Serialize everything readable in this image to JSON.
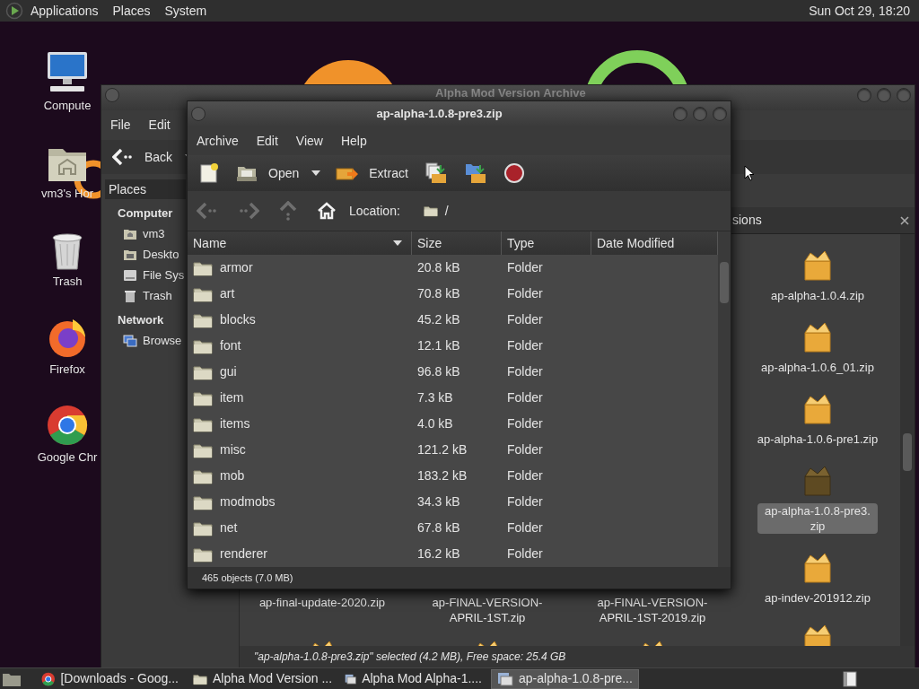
{
  "top_panel": {
    "menus": [
      "Applications",
      "Places",
      "System"
    ],
    "clock": "Sun Oct 29, 18:20"
  },
  "desktop_icons": [
    {
      "kind": "computer",
      "label": "Compute"
    },
    {
      "kind": "home",
      "label": "vm3's Hor"
    },
    {
      "kind": "trash",
      "label": "Trash"
    },
    {
      "kind": "firefox",
      "label": "Firefox"
    },
    {
      "kind": "chrome",
      "label": "Google Chr"
    }
  ],
  "file_manager": {
    "title": "Alpha Mod Version Archive",
    "menus": [
      "File",
      "Edit"
    ],
    "back_button": "Back",
    "places_header": "Places",
    "sidebar": [
      {
        "heading": "Computer",
        "items": [
          {
            "kind": "home",
            "label": "vm3"
          },
          {
            "kind": "desktop",
            "label": "Deskto"
          },
          {
            "kind": "drive",
            "label": "File Sys"
          },
          {
            "kind": "trash",
            "label": "Trash"
          }
        ]
      },
      {
        "heading": "Network",
        "items": [
          {
            "kind": "network",
            "label": "Browse"
          }
        ]
      }
    ],
    "tab": "sions",
    "files_column": [
      {
        "name": "ap-alpha-1.0.4.zip",
        "selected": false
      },
      {
        "name": "ap-alpha-1.0.6_01.zip",
        "selected": false
      },
      {
        "name": "ap-alpha-1.0.6-pre1.zip",
        "selected": false
      },
      {
        "name": "ap-alpha-1.0.8-pre3.zip",
        "selected": true
      },
      {
        "name": "ap-indev-201912.zip",
        "selected": false
      }
    ],
    "files_bottom_row": [
      {
        "name": "ap-final-update-2020.zip",
        "selected": false
      },
      {
        "name": "ap-FINAL-VERSION-APRIL-1ST.zip",
        "selected": false
      },
      {
        "name": "ap-FINAL-VERSION-APRIL-1ST-2019.zip",
        "selected": false
      }
    ],
    "status": "\"ap-alpha-1.0.8-pre3.zip\" selected (4.2 MB), Free space: 25.4 GB"
  },
  "archive_manager": {
    "title": "ap-alpha-1.0.8-pre3.zip",
    "menus": [
      "Archive",
      "Edit",
      "View",
      "Help"
    ],
    "toolbar": [
      {
        "kind": "new"
      },
      {
        "kind": "open",
        "label": "Open"
      },
      {
        "kind": "extract",
        "label": "Extract"
      },
      {
        "kind": "add_files"
      },
      {
        "kind": "add_folder"
      },
      {
        "kind": "stop"
      }
    ],
    "nav": [
      {
        "kind": "back",
        "disabled": true
      },
      {
        "kind": "forward",
        "disabled": true
      },
      {
        "kind": "up",
        "disabled": true
      },
      {
        "kind": "home",
        "disabled": false
      }
    ],
    "location_label": "Location:",
    "path": "/",
    "columns": [
      {
        "label": "Name",
        "sorted": true
      },
      {
        "label": "Size",
        "sorted": false
      },
      {
        "label": "Type",
        "sorted": false
      },
      {
        "label": "Date Modified",
        "sorted": false
      }
    ],
    "rows": [
      {
        "name": "armor",
        "size": "20.8 kB",
        "type": "Folder"
      },
      {
        "name": "art",
        "size": "70.8 kB",
        "type": "Folder"
      },
      {
        "name": "blocks",
        "size": "45.2 kB",
        "type": "Folder"
      },
      {
        "name": "font",
        "size": "12.1 kB",
        "type": "Folder"
      },
      {
        "name": "gui",
        "size": "96.8 kB",
        "type": "Folder"
      },
      {
        "name": "item",
        "size": "7.3 kB",
        "type": "Folder"
      },
      {
        "name": "items",
        "size": "4.0 kB",
        "type": "Folder"
      },
      {
        "name": "misc",
        "size": "121.2 kB",
        "type": "Folder"
      },
      {
        "name": "mob",
        "size": "183.2 kB",
        "type": "Folder"
      },
      {
        "name": "modmobs",
        "size": "34.3 kB",
        "type": "Folder"
      },
      {
        "name": "net",
        "size": "67.8 kB",
        "type": "Folder"
      },
      {
        "name": "renderer",
        "size": "16.2 kB",
        "type": "Folder"
      }
    ],
    "status": "465 objects (7.0 MB)"
  },
  "taskbar": {
    "items": [
      {
        "kind": "chrome",
        "label": "[Downloads - Goog...",
        "selected": false
      },
      {
        "kind": "folder",
        "label": "Alpha Mod Version ...",
        "selected": false
      },
      {
        "kind": "archive",
        "label": "Alpha Mod Alpha-1....",
        "selected": false
      },
      {
        "kind": "archive",
        "label": "ap-alpha-1.0.8-pre...",
        "selected": true
      }
    ]
  }
}
